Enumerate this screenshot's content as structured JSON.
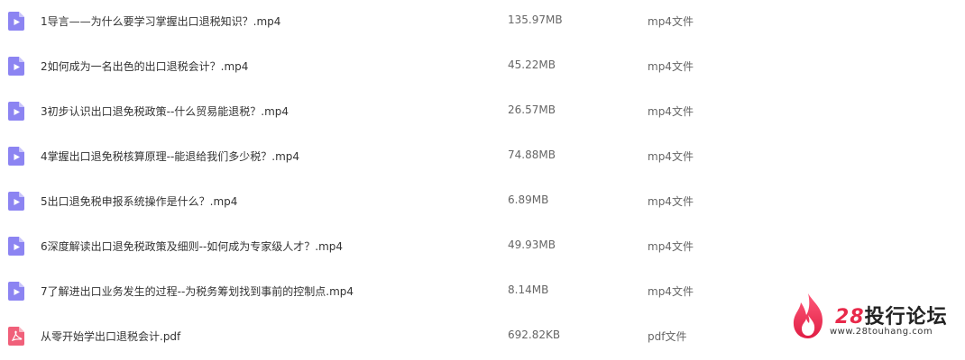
{
  "files": [
    {
      "name": "1导言——为什么要学习掌握出口退税知识？.mp4",
      "size": "135.97MB",
      "type": "mp4文件",
      "icon": "video-file-icon"
    },
    {
      "name": "2如何成为一名出色的出口退税会计？.mp4",
      "size": "45.22MB",
      "type": "mp4文件",
      "icon": "video-file-icon"
    },
    {
      "name": "3初步认识出口退免税政策--什么贸易能退税？.mp4",
      "size": "26.57MB",
      "type": "mp4文件",
      "icon": "video-file-icon"
    },
    {
      "name": "4掌握出口退免税核算原理--能退给我们多少税？.mp4",
      "size": "74.88MB",
      "type": "mp4文件",
      "icon": "video-file-icon"
    },
    {
      "name": "5出口退免税申报系统操作是什么？.mp4",
      "size": "6.89MB",
      "type": "mp4文件",
      "icon": "video-file-icon"
    },
    {
      "name": "6深度解读出口退免税政策及细则--如何成为专家级人才？.mp4",
      "size": "49.93MB",
      "type": "mp4文件",
      "icon": "video-file-icon"
    },
    {
      "name": "7了解进出口业务发生的过程--为税务筹划找到事前的控制点.mp4",
      "size": "8.14MB",
      "type": "mp4文件",
      "icon": "video-file-icon"
    },
    {
      "name": "从零开始学出口退税会计.pdf",
      "size": "692.82KB",
      "type": "pdf文件",
      "icon": "pdf-file-icon"
    }
  ],
  "watermark": {
    "number": "28",
    "title": "投行论坛",
    "url": "www.28touhang.com"
  },
  "colors": {
    "video_icon": "#8c84f2",
    "pdf_icon": "#f0607a",
    "brand": "#e8294a"
  }
}
